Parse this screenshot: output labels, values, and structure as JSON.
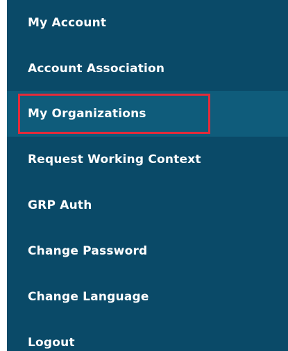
{
  "menu": {
    "items": [
      {
        "label": "My Account",
        "active": false
      },
      {
        "label": "Account Association",
        "active": false
      },
      {
        "label": "My Organizations",
        "active": true
      },
      {
        "label": "Request Working Context",
        "active": false
      },
      {
        "label": "GRP Auth",
        "active": false
      },
      {
        "label": "Change Password",
        "active": false
      },
      {
        "label": "Change Language",
        "active": false
      },
      {
        "label": "Logout",
        "active": false
      }
    ]
  },
  "colors": {
    "menu_background": "#0a4a68",
    "active_item_background": "#0f5c7b",
    "menu_text": "#ffffff",
    "highlight_border": "#e32b3a",
    "page_background": "#ffffff"
  }
}
